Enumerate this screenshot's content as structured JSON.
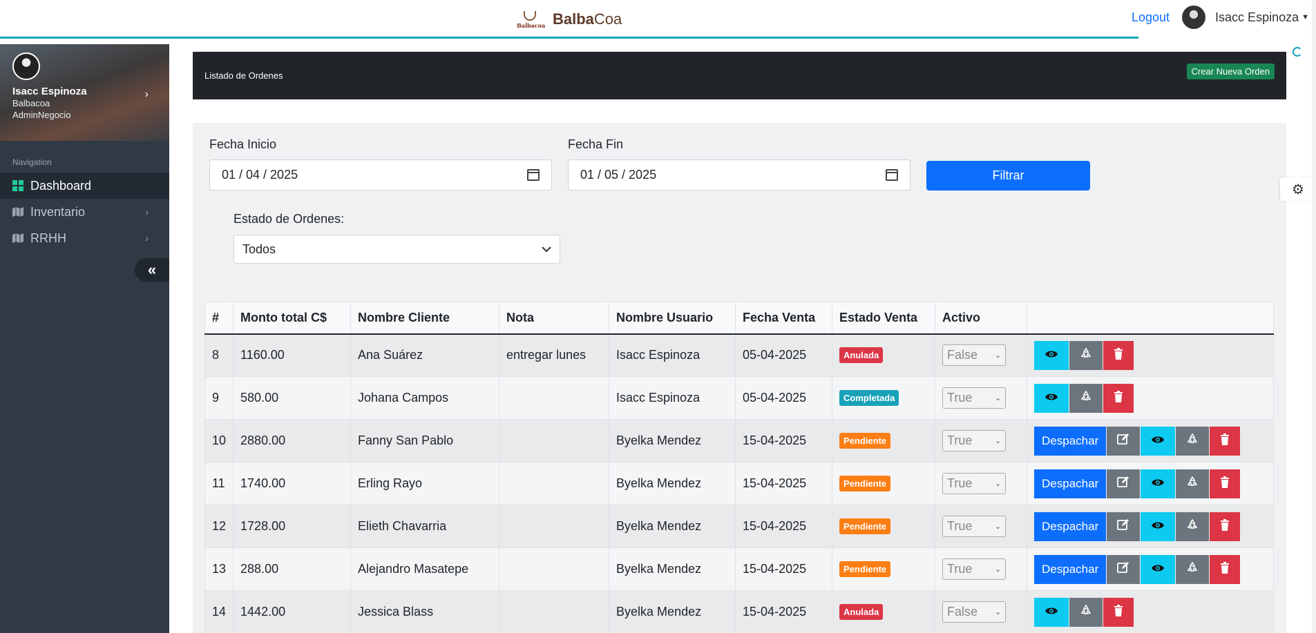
{
  "header": {
    "brand_logo_text": "Balbacoa",
    "brand_bold": "Balba",
    "brand_light": "Coa",
    "logout": "Logout",
    "user_name": "Isacc Espinoza"
  },
  "sidebar": {
    "profile": {
      "name": "Isacc Espinoza",
      "company": "Balbacoa",
      "role": "AdminNegocio"
    },
    "nav_header": "Navigation",
    "items": [
      {
        "label": "Dashboard",
        "icon": "dashboard-icon",
        "active": true
      },
      {
        "label": "Inventario",
        "icon": "map-icon"
      },
      {
        "label": "RRHH",
        "icon": "map-icon"
      }
    ]
  },
  "card": {
    "title": "Listado de Ordenes",
    "create_button": "Crear Nueva Orden"
  },
  "filters": {
    "start_label": "Fecha Inicio",
    "start_value": "01 / 04 / 2025",
    "end_label": "Fecha Fin",
    "end_value": "01 / 05 / 2025",
    "filter_button": "Filtrar",
    "status_label": "Estado de Ordenes:",
    "status_value": "Todos"
  },
  "table": {
    "columns": [
      "#",
      "Monto total C$",
      "Nombre Cliente",
      "Nota",
      "Nombre Usuario",
      "Fecha Venta",
      "Estado Venta",
      "Activo",
      ""
    ],
    "rows": [
      {
        "id": "8",
        "monto": "1160.00",
        "cliente": "Ana Suárez",
        "nota": "entregar lunes",
        "usuario": "Isacc Espinoza",
        "fecha": "05-04-2025",
        "estado": "Anulada",
        "activo": "False"
      },
      {
        "id": "9",
        "monto": "580.00",
        "cliente": "Johana Campos",
        "nota": "",
        "usuario": "Isacc Espinoza",
        "fecha": "05-04-2025",
        "estado": "Completada",
        "activo": "True"
      },
      {
        "id": "10",
        "monto": "2880.00",
        "cliente": "Fanny San Pablo",
        "nota": "",
        "usuario": "Byelka Mendez",
        "fecha": "15-04-2025",
        "estado": "Pendiente",
        "activo": "True"
      },
      {
        "id": "11",
        "monto": "1740.00",
        "cliente": "Erling Rayo",
        "nota": "",
        "usuario": "Byelka Mendez",
        "fecha": "15-04-2025",
        "estado": "Pendiente",
        "activo": "True"
      },
      {
        "id": "12",
        "monto": "1728.00",
        "cliente": "Elieth Chavarria",
        "nota": "",
        "usuario": "Byelka Mendez",
        "fecha": "15-04-2025",
        "estado": "Pendiente",
        "activo": "True"
      },
      {
        "id": "13",
        "monto": "288.00",
        "cliente": "Alejandro Masatepe",
        "nota": "",
        "usuario": "Byelka Mendez",
        "fecha": "15-04-2025",
        "estado": "Pendiente",
        "activo": "True"
      },
      {
        "id": "14",
        "monto": "1442.00",
        "cliente": "Jessica Blass",
        "nota": "",
        "usuario": "Byelka Mendez",
        "fecha": "15-04-2025",
        "estado": "Anulada",
        "activo": "False"
      }
    ],
    "despachar_label": "Despachar"
  },
  "colors": {
    "primary": "#0d6efd",
    "success": "#198754",
    "danger": "#dc3545",
    "info": "#0dcaf0",
    "warning": "#fd7e14",
    "sidebar_bg": "#2f3a45",
    "accent_line": "#17a2b8"
  }
}
